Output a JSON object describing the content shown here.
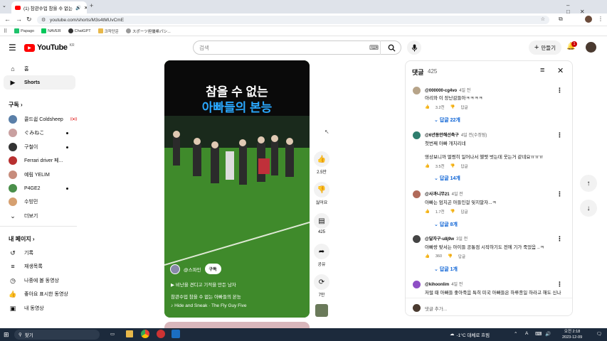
{
  "browser": {
    "tab_title": "(1) 참관수업 참을 수 없는",
    "url": "youtube.com/shorts/M3s4tMUvCmE",
    "bookmarks": [
      "Papago",
      "NAVER",
      "ChatGPT",
      "크작단운",
      "スポーツ担優希パシ..."
    ]
  },
  "header": {
    "logo": "YouTube",
    "region": "KR",
    "search_placeholder": "검색",
    "create_label": "만들기",
    "notif_count": "1"
  },
  "sidebar": {
    "home": "홈",
    "shorts": "Shorts",
    "subs_title": "구독",
    "subs": [
      {
        "name": "콜드쉽 Coldsheep",
        "color": "#5a7fa8"
      },
      {
        "name": "ぐみねこ",
        "color": "#c9a0a0"
      },
      {
        "name": "구철이",
        "color": "#333333"
      },
      {
        "name": "Ferrari driver 페...",
        "color": "#b83030"
      },
      {
        "name": "예림 YELIM",
        "color": "#c78c7c"
      },
      {
        "name": "P4GE2",
        "color": "#4a8f4a"
      },
      {
        "name": "수빙민",
        "color": "#d6a070"
      }
    ],
    "more": "더보기",
    "my_title": "내 페이지",
    "my_items": [
      "기록",
      "재생목록",
      "나중에 볼 동영상",
      "좋아요 표시한 동영상",
      "내 동영상"
    ]
  },
  "video": {
    "title_line1": "참을 수 없는",
    "title_line2": "아빠들의 본능",
    "channel": "@스파인",
    "subscribe": "구독",
    "desc1": "비난을 견디고 기적을 만든 남자",
    "desc2": "참관수업 참을 수 없는 아빠들의 본능",
    "music": "Hide and Sneak · The Fly Guy Five"
  },
  "actions": {
    "like": "2.5만",
    "dislike": "싫어요",
    "comments": "425",
    "share": "공유",
    "remix": "7만"
  },
  "comments": {
    "title": "댓글",
    "count": "425",
    "add_placeholder": "댓글 추가...",
    "items": [
      {
        "user": "@000000-cg4vo",
        "time": "4일 전",
        "text": [
          "아리와 이 장난감들아ㅋㅋㅋㅋ"
        ],
        "likes": "3.2천",
        "reply": "답글",
        "replies": "답글 22개",
        "color": "#b7a489"
      },
      {
        "user": "@6년동안해선축구",
        "time": "4일 전(수정됨)",
        "text": [
          "첫번째 아빠 개치리네",
          "",
          "영상보니까 멀쩡히 일어나서 헬멧 벗는데 웃는거 같네요ㅠㅠㅠ"
        ],
        "likes": "3.5천",
        "reply": "답글",
        "replies": "답글 14개",
        "color": "#2f7e6e"
      },
      {
        "user": "@사과니무21",
        "time": "4일 전",
        "text": [
          "아빠는 엄치곤 아들인걸 잊지말자...ㅋ"
        ],
        "likes": "1.7천",
        "reply": "답글",
        "replies": "답글 8개",
        "color": "#b06a5a"
      },
      {
        "user": "@달자구-u8j9w",
        "time": "3일 전",
        "text": [
          "아빠랑 맞서는 아이들 공통점 시작하기도 전에 기가 죽었음 ..ㅋ"
        ],
        "likes": "360",
        "reply": "답글",
        "replies": "답글 1개",
        "color": "#444444"
      },
      {
        "user": "@kihoonlim",
        "time": "4일 전",
        "text": [
          "저럴 때 아빠들 좋아죽음 특히 미국 아빠들은 하루종일 하라고 해도 신나"
        ],
        "likes": "",
        "reply": "",
        "replies": "",
        "color": "#8e4fc5"
      }
    ]
  },
  "taskbar": {
    "search": "찾기",
    "weather": "-1°C 대체로 흐림",
    "time": "오전 2:18",
    "date": "2023-12-09",
    "lang": "A"
  }
}
